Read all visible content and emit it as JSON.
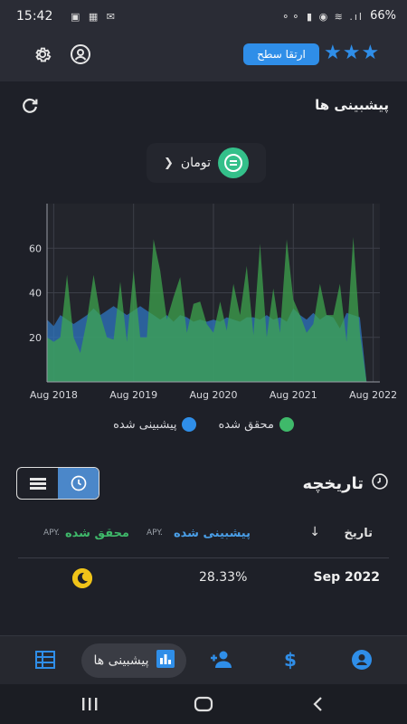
{
  "status_bar": {
    "time": "15:42",
    "battery": "66%",
    "left_icons": "▣ ▦ ✉",
    "right_icons": "⚬⚬ ▮ ◉ ≋ .ıl"
  },
  "header": {
    "upgrade_label": "ارتقا سطح",
    "stars": "★★★"
  },
  "predictions": {
    "title": "پیشبینی ها",
    "currency": "تومان"
  },
  "chart_data": {
    "type": "area",
    "x_ticks": [
      "Aug 2018",
      "Aug 2019",
      "Aug 2020",
      "Aug 2021",
      "Aug 2022"
    ],
    "x_range": [
      "2018-07",
      "2022-09"
    ],
    "ylim": [
      0,
      80
    ],
    "y_ticks": [
      20,
      40,
      60
    ],
    "grid": true,
    "legend_position": "bottom",
    "series": [
      {
        "name": "پیشبینی شده",
        "color": "#2f78c6",
        "points": [
          [
            "2018-07",
            28
          ],
          [
            "2018-08",
            25
          ],
          [
            "2018-09",
            30
          ],
          [
            "2018-10",
            28
          ],
          [
            "2018-11",
            26
          ],
          [
            "2018-12",
            28
          ],
          [
            "2019-01",
            30
          ],
          [
            "2019-02",
            33
          ],
          [
            "2019-03",
            30
          ],
          [
            "2019-04",
            32
          ],
          [
            "2019-05",
            34
          ],
          [
            "2019-06",
            32
          ],
          [
            "2019-07",
            30
          ],
          [
            "2019-08",
            32
          ],
          [
            "2019-09",
            34
          ],
          [
            "2019-10",
            32
          ],
          [
            "2019-11",
            30
          ],
          [
            "2019-12",
            28
          ],
          [
            "2020-01",
            30
          ],
          [
            "2020-02",
            27
          ],
          [
            "2020-03",
            30
          ],
          [
            "2020-04",
            29
          ],
          [
            "2020-05",
            27
          ],
          [
            "2020-06",
            28
          ],
          [
            "2020-07",
            27
          ],
          [
            "2020-08",
            28
          ],
          [
            "2020-09",
            27
          ],
          [
            "2020-10",
            29
          ],
          [
            "2020-11",
            28
          ],
          [
            "2020-12",
            27
          ],
          [
            "2021-01",
            29
          ],
          [
            "2021-02",
            29
          ],
          [
            "2021-03",
            28
          ],
          [
            "2021-04",
            30
          ],
          [
            "2021-05",
            28
          ],
          [
            "2021-06",
            29
          ],
          [
            "2021-07",
            27
          ],
          [
            "2021-08",
            33
          ],
          [
            "2021-09",
            30
          ],
          [
            "2021-10",
            28
          ],
          [
            "2021-11",
            31
          ],
          [
            "2021-12",
            28
          ],
          [
            "2022-01",
            30
          ],
          [
            "2022-02",
            29
          ],
          [
            "2022-03",
            24
          ],
          [
            "2022-04",
            31
          ],
          [
            "2022-05",
            30
          ],
          [
            "2022-06",
            29
          ],
          [
            "2022-07",
            0
          ]
        ]
      },
      {
        "name": "محقق شده",
        "color": "#3ea84e",
        "points": [
          [
            "2018-07",
            20
          ],
          [
            "2018-08",
            18
          ],
          [
            "2018-09",
            20
          ],
          [
            "2018-10",
            48
          ],
          [
            "2018-11",
            20
          ],
          [
            "2018-12",
            13
          ],
          [
            "2019-01",
            28
          ],
          [
            "2019-02",
            48
          ],
          [
            "2019-03",
            30
          ],
          [
            "2019-04",
            20
          ],
          [
            "2019-05",
            19
          ],
          [
            "2019-06",
            45
          ],
          [
            "2019-07",
            18
          ],
          [
            "2019-08",
            50
          ],
          [
            "2019-09",
            20
          ],
          [
            "2019-10",
            20
          ],
          [
            "2019-11",
            64
          ],
          [
            "2019-12",
            50
          ],
          [
            "2020-01",
            28
          ],
          [
            "2020-02",
            38
          ],
          [
            "2020-03",
            47
          ],
          [
            "2020-04",
            22
          ],
          [
            "2020-05",
            35
          ],
          [
            "2020-06",
            36
          ],
          [
            "2020-07",
            26
          ],
          [
            "2020-08",
            22
          ],
          [
            "2020-09",
            36
          ],
          [
            "2020-10",
            23
          ],
          [
            "2020-11",
            44
          ],
          [
            "2020-12",
            30
          ],
          [
            "2021-01",
            52
          ],
          [
            "2021-02",
            21
          ],
          [
            "2021-03",
            62
          ],
          [
            "2021-04",
            20
          ],
          [
            "2021-05",
            42
          ],
          [
            "2021-06",
            22
          ],
          [
            "2021-07",
            64
          ],
          [
            "2021-08",
            37
          ],
          [
            "2021-09",
            30
          ],
          [
            "2021-10",
            22
          ],
          [
            "2021-11",
            26
          ],
          [
            "2021-12",
            44
          ],
          [
            "2022-01",
            30
          ],
          [
            "2022-02",
            30
          ],
          [
            "2022-03",
            44
          ],
          [
            "2022-04",
            18
          ],
          [
            "2022-05",
            65
          ],
          [
            "2022-06",
            22
          ],
          [
            "2022-07",
            0
          ]
        ]
      }
    ],
    "legend": [
      {
        "label": "محقق شده",
        "color": "#3fb96a"
      },
      {
        "label": "پیشبینی شده",
        "color": "#2f8ee8"
      }
    ]
  },
  "history": {
    "title": "تاریخچه",
    "columns": {
      "date": "تاریخ",
      "predicted": "پیشبینی شده",
      "predicted_unit": "APY.",
      "realized": "محقق شده",
      "realized_unit": "APY."
    },
    "rows": [
      {
        "date": "Sep 2022",
        "predicted": "28.33%"
      }
    ]
  },
  "nav": {
    "predictions_label": "پیشبینی ها"
  }
}
